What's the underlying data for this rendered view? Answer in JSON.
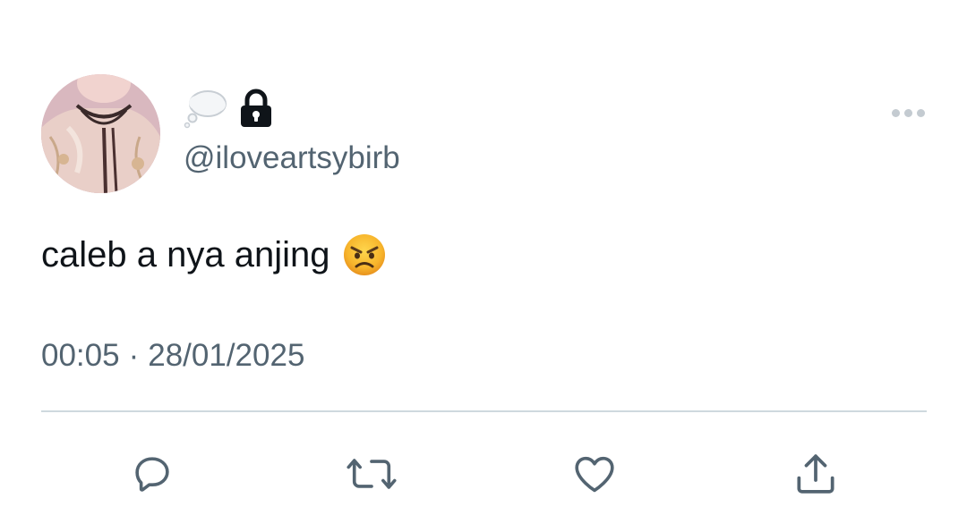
{
  "tweet": {
    "display_name_icons": [
      "thought-balloon-icon",
      "lock-icon"
    ],
    "handle": "@iloveartsybirb",
    "text": "caleb a nya anjing",
    "text_emoji": "angry-face-icon",
    "time": "00:05",
    "separator": "·",
    "date": "28/01/2025"
  },
  "actions": [
    {
      "name": "reply",
      "icon": "comment-icon"
    },
    {
      "name": "retweet",
      "icon": "retweet-icon"
    },
    {
      "name": "like",
      "icon": "heart-icon"
    },
    {
      "name": "share",
      "icon": "share-icon"
    }
  ],
  "colors": {
    "text": "#0f1419",
    "secondary": "#536471",
    "divider": "#cfd9de",
    "icon": "#536471"
  }
}
